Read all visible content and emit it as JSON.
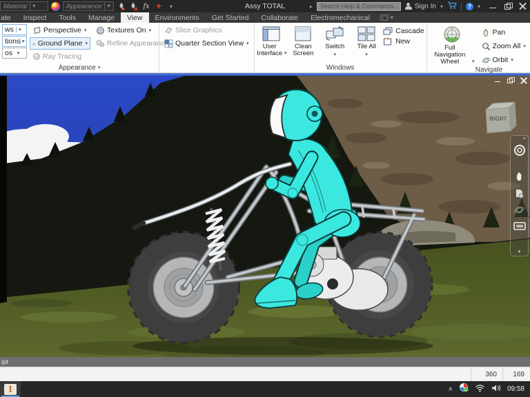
{
  "titlebar": {
    "material_label": "Material",
    "appearance_label": "Appearance",
    "document_title": "Assy TOTAL",
    "search_placeholder": "Search Help & Commands...",
    "sign_in_label": "Sign In",
    "window_controls": [
      "minimize",
      "restore",
      "close"
    ]
  },
  "tabs": {
    "items": [
      "ate",
      "Inspect",
      "Tools",
      "Manage",
      "View",
      "Environments",
      "Get Started",
      "Collaborate",
      "Electromechanical"
    ],
    "active": "View"
  },
  "ribbon": {
    "appearance": {
      "label": "Appearance",
      "shadows_clipped": "ws",
      "reflections_clipped": "tions",
      "styles_clipped": "os",
      "perspective": "Perspective",
      "ground_plane": "Ground Plane",
      "ray_tracing": "Ray Tracing",
      "textures_on": "Textures On",
      "refine_appearance": "Refine Appearance"
    },
    "section": {
      "slice_graphics": "Slice Graphics",
      "quarter_section_view": "Quarter Section View"
    },
    "windows": {
      "label": "Windows",
      "user_interface": "User Interface",
      "clean_screen": "Clean Screen",
      "switch": "Switch",
      "tile_all": "Tile All",
      "cascade": "Cascade",
      "new": "New"
    },
    "navigate": {
      "label": "Navigate",
      "full_navigation_wheel": "Full Navigation Wheel",
      "pan": "Pan",
      "zoom_all": "Zoom All",
      "orbit": "Orbit"
    }
  },
  "viewport": {
    "viewcube_face": "RIGHT"
  },
  "doc_tab_bar": {
    "clipped_text": "ipt"
  },
  "status_bar": {
    "counters": [
      "360",
      "169"
    ]
  },
  "taskbar": {
    "time": "09:58"
  },
  "glyphs": {
    "dropdown": "▾",
    "flyout": "▸",
    "close_x": "×",
    "tray_chevron": "∧",
    "fx": "fx",
    "plus": "+",
    "help": "?"
  },
  "colors": {
    "selection_blue": "#84b3de",
    "rider_cyan": "#3BE8E0",
    "sky_blue": "#2b49c4",
    "taskbar_accent": "#55a6e8"
  }
}
